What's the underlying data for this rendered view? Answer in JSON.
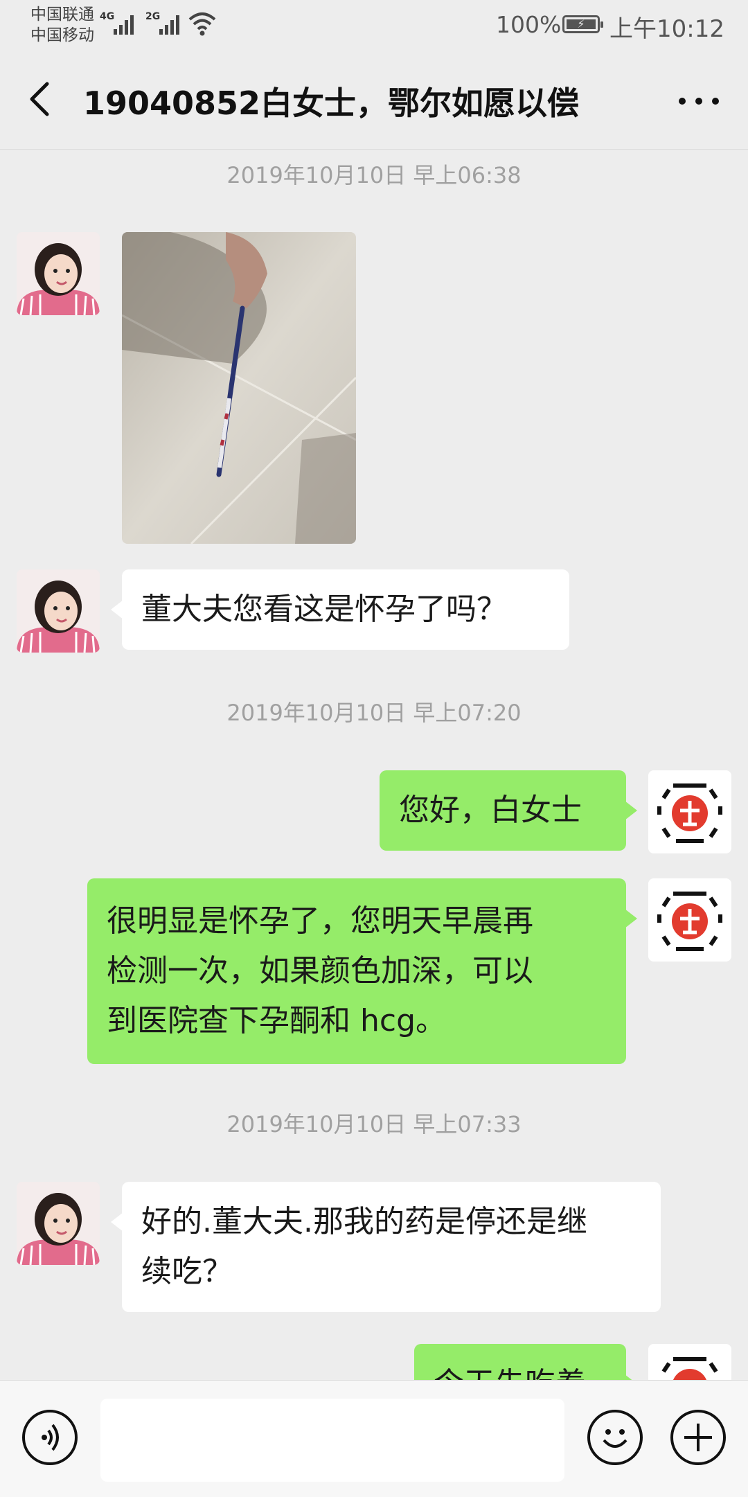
{
  "status_bar": {
    "carrier_1": "中国联通",
    "carrier_2": "中国移动",
    "network_1": "4G",
    "network_2": "2G",
    "battery_percent": "100%",
    "time": "上午10:12",
    "icons": [
      "signal-icon",
      "wifi-icon",
      "battery-charging-icon"
    ]
  },
  "nav": {
    "title": "19040852白女士，鄂尔如愿以偿",
    "back_icon": "back-arrow-icon",
    "more_icon": "more-dots-icon"
  },
  "messages": [
    {
      "type": "timestamp",
      "text": "2019年10月10日 早上06:38"
    },
    {
      "type": "image",
      "sender": "patient"
    },
    {
      "type": "text",
      "sender": "patient",
      "lines": [
        "董大夫您看这是怀孕了吗？"
      ]
    },
    {
      "type": "timestamp",
      "text": "2019年10月10日 早上07:20"
    },
    {
      "type": "text",
      "sender": "doctor",
      "lines": [
        "您好，白女士"
      ]
    },
    {
      "type": "text",
      "sender": "doctor",
      "lines": [
        "很明显是怀孕了，您明天早晨再",
        "检测一次，如果颜色加深，可以",
        "到医院查下孕酮和 hcg。"
      ]
    },
    {
      "type": "timestamp",
      "text": "2019年10月10日 早上07:33"
    },
    {
      "type": "text",
      "sender": "patient",
      "lines": [
        "好的.董大夫.那我的药是停还是继",
        "续吃？"
      ]
    },
    {
      "type": "text",
      "sender": "doctor",
      "lines": [
        "今天先吃着"
      ],
      "partially_hidden": true
    }
  ],
  "input_bar": {
    "voice_icon": "voice-icon",
    "emoji_icon": "emoji-icon",
    "plus_icon": "plus-icon"
  },
  "colors": {
    "background": "#ededed",
    "outgoing_bubble": "#95ec69",
    "incoming_bubble": "#ffffff",
    "timestamp_text": "#a0a0a0"
  }
}
